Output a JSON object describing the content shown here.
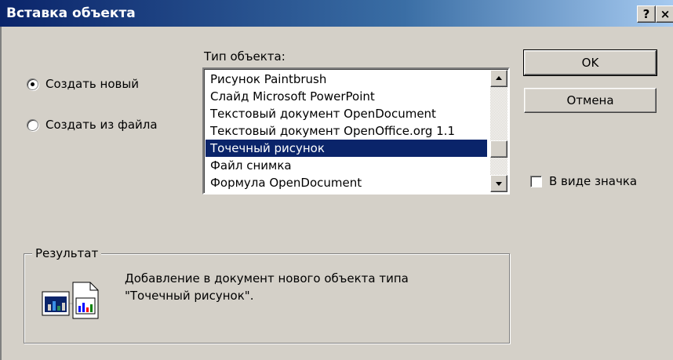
{
  "window": {
    "title": "Вставка объекта",
    "help_button": "?",
    "close_button": "×"
  },
  "options": {
    "create_new": "Создать новый",
    "create_from_file": "Создать из файла",
    "selected": "create_new"
  },
  "object_type": {
    "label": "Тип объекта:",
    "items": [
      "Рисунок Paintbrush",
      "Слайд Microsoft PowerPoint",
      "Текстовый документ OpenDocument",
      "Текстовый документ OpenOffice.org 1.1",
      "Точечный рисунок",
      "Файл снимка",
      "Формула OpenDocument"
    ],
    "selected_index": 4
  },
  "buttons": {
    "ok": "OK",
    "cancel": "Отмена"
  },
  "display_as_icon": {
    "label": "В виде значка",
    "checked": false
  },
  "result": {
    "legend": "Результат",
    "line1": "Добавление в документ нового объекта типа",
    "line2": "\"Точечный рисунок\"."
  },
  "colors": {
    "title_bar": "#0a246a",
    "selection": "#0a246a",
    "face": "#d4d0c8"
  }
}
